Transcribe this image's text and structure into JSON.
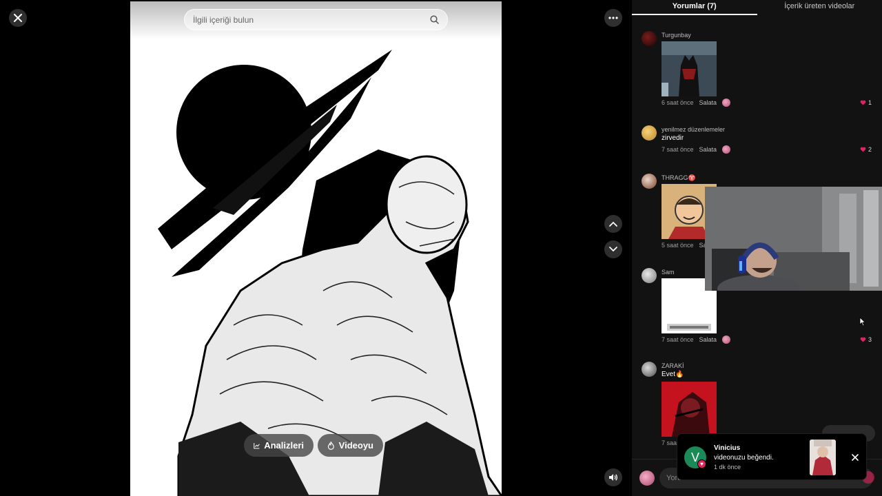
{
  "search": {
    "placeholder": "İlgili içeriği bulun"
  },
  "viewer": {
    "analytics_label": "Analizleri",
    "video_label": "Videoyu"
  },
  "tabs": [
    {
      "label": "Yorumlar (7)",
      "active": true
    },
    {
      "label": "İçerik üreten videolar",
      "active": false
    }
  ],
  "comments": [
    {
      "user": "Turgunbay",
      "text": "",
      "time": "6 saat önce",
      "reply": "Salata",
      "likes": "1",
      "thumb": "batman-image"
    },
    {
      "user": "yenilmez düzenlemeler",
      "text": "zirvedir",
      "time": "7 saat önce",
      "reply": "Salata",
      "likes": "2"
    },
    {
      "user": "THRAGG♈",
      "text": "",
      "time": "5 saat önce",
      "reply": "Sa",
      "likes": "",
      "thumb": "comic-hero-image"
    },
    {
      "user": "Sam",
      "text": "",
      "time": "7 saat önce",
      "reply": "Salata",
      "likes": "3",
      "thumb": "white-image"
    },
    {
      "user": "ZARAKİ",
      "text": "Evet🔥",
      "time": "7 saa",
      "reply": "",
      "likes": "",
      "thumb": "red-comic-image"
    }
  ],
  "comment_bar": {
    "placeholder": "Yoru"
  },
  "toast": {
    "avatar_letter": "V",
    "name": "Vinicius",
    "message": "videonuzu beğendi.",
    "time": "1 dk önce"
  },
  "colors": {
    "accent": "#e0245e",
    "panel_bg": "#121212",
    "toast_avatar": "#1b8a57"
  },
  "icons": [
    "close-icon",
    "more-icon",
    "chevron-up-icon",
    "chevron-down-icon",
    "volume-icon",
    "search-icon",
    "chart-icon",
    "flame-icon",
    "heart-icon"
  ]
}
